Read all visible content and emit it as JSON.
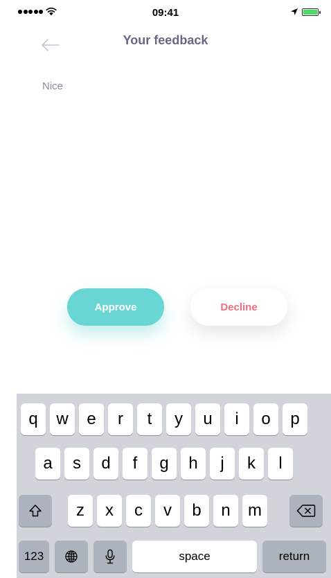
{
  "status_bar": {
    "time": "09:41",
    "icons": [
      "signal-icon",
      "wifi-icon",
      "location-icon",
      "battery-icon"
    ],
    "battery_color": "#4cd964"
  },
  "header": {
    "title": "Your feedback",
    "back_icon": "arrow-left-icon"
  },
  "feedback": {
    "text": "Nice"
  },
  "actions": {
    "approve_label": "Approve",
    "decline_label": "Decline",
    "approve_color": "#6ad6d3",
    "decline_text_color": "#f26d7d"
  },
  "keyboard": {
    "row1": [
      "q",
      "w",
      "e",
      "r",
      "t",
      "y",
      "u",
      "i",
      "o",
      "p"
    ],
    "row2": [
      "a",
      "s",
      "d",
      "f",
      "g",
      "h",
      "j",
      "k",
      "l"
    ],
    "row3": [
      "z",
      "x",
      "c",
      "v",
      "b",
      "n",
      "m"
    ],
    "numbers_label": "123",
    "space_label": "space",
    "return_label": "return",
    "icons": [
      "shift-icon",
      "backspace-icon",
      "globe-icon",
      "microphone-icon"
    ]
  }
}
